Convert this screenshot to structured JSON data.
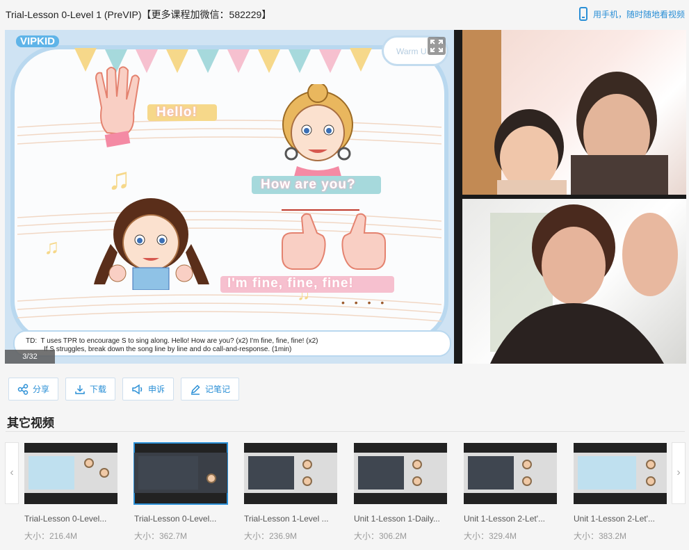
{
  "header": {
    "title": "Trial-Lesson 0-Level 1 (PreVIP)【更多课程加微信：582229】",
    "mobile_label": "用手机，随时随地看视频"
  },
  "player": {
    "logo": "VIPKID",
    "warm_label": "Warm U",
    "lyrics": [
      "Hello!",
      "How are you?",
      "I'm fine, fine, fine!"
    ],
    "note_prefix": "TD:",
    "note_line1": "T uses TPR to encourage S to sing along. Hello! How are you? (x2)  I'm fine, fine, fine! (x2)",
    "note_line2": "If S struggles, break down the song line by line and do call-and-response. (1min)",
    "page_indicator": "3/32"
  },
  "actions": [
    {
      "label": "分享",
      "icon": "share-icon"
    },
    {
      "label": "下载",
      "icon": "download-icon"
    },
    {
      "label": "申诉",
      "icon": "megaphone-icon"
    },
    {
      "label": "记笔记",
      "icon": "pencil-icon"
    }
  ],
  "section_title": "其它视频",
  "carousel": {
    "prev": "‹",
    "next": "›"
  },
  "videos": [
    {
      "name": "Trial-Lesson 0-Level...",
      "size": "大小：216.4M"
    },
    {
      "name": "Trial-Lesson 0-Level...",
      "size": "大小：362.7M"
    },
    {
      "name": "Trial-Lesson 1-Level ...",
      "size": "大小：236.9M"
    },
    {
      "name": "Unit 1-Lesson 1-Daily...",
      "size": "大小：306.2M"
    },
    {
      "name": "Unit 1-Lesson 2-Let'...",
      "size": "大小：329.4M"
    },
    {
      "name": "Unit 1-Lesson 2-Let'...",
      "size": "大小：383.2M"
    }
  ],
  "colors": {
    "accent": "#2a8fd6"
  }
}
